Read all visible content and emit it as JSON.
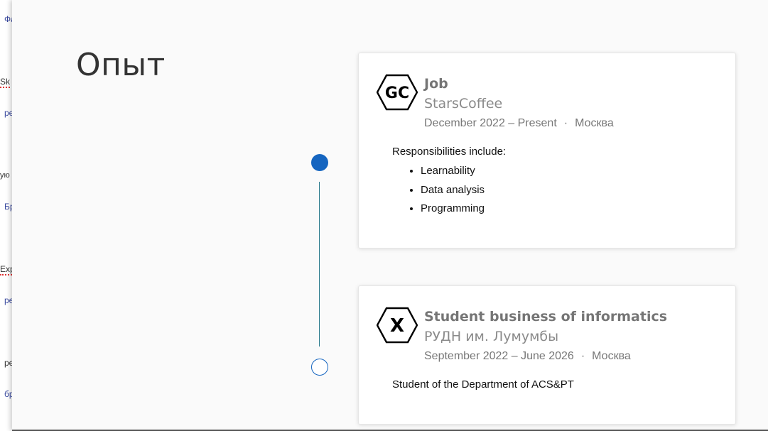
{
  "background_fragments": [
    "Фа",
    "Sk",
    "ре",
    "ую",
    "Бр",
    "Exp",
    "ре",
    "ре",
    "бр"
  ],
  "section_title": "Опыт",
  "experiences": [
    {
      "logo_text": "GC",
      "role": "Job",
      "organization": "StarsCoffee",
      "dates": "December 2022 – Present",
      "separator": "·",
      "location": "Москва",
      "intro": "Responsibilities include:",
      "bullets": [
        "Learnability",
        "Data analysis",
        "Programming"
      ]
    },
    {
      "logo_text": "X",
      "role": "Student business of informatics",
      "organization": "РУДН им. Лумумбы",
      "dates": "September 2022 – June 2026",
      "separator": "·",
      "location": "Москва",
      "description": "Student of the Department of ACS&PT"
    }
  ],
  "colors": {
    "accent": "#1565c0",
    "timeline_line": "#2a7a8c",
    "text_muted": "#777777"
  }
}
